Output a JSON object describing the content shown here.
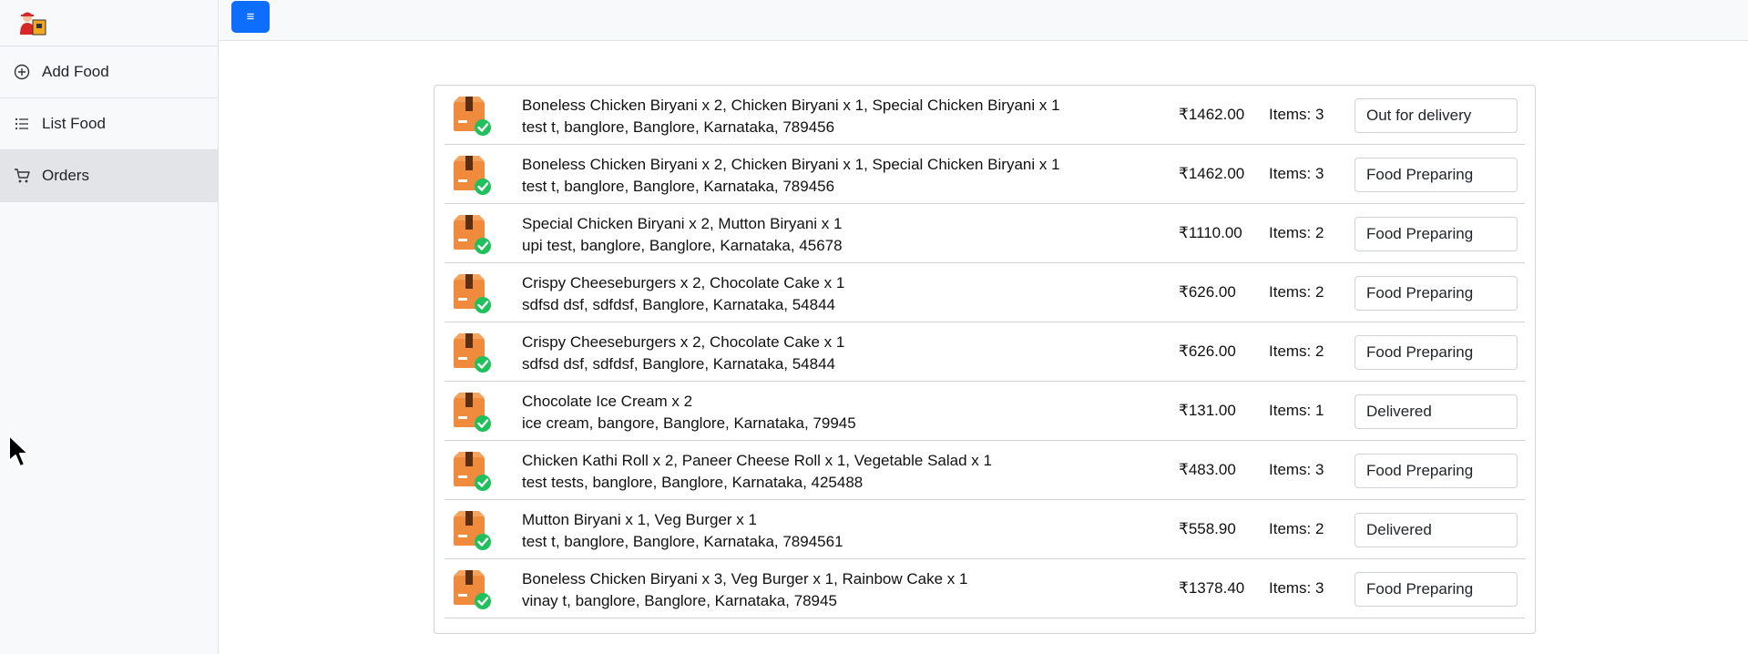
{
  "sidebar": {
    "logo_icon": "delivery-person-icon",
    "items": [
      {
        "label": "Add Food",
        "icon": "plus-circle-icon"
      },
      {
        "label": "List Food",
        "icon": "list-icon"
      },
      {
        "label": "Orders",
        "icon": "cart-icon",
        "active": true
      }
    ]
  },
  "topbar": {
    "menu_icon": "hamburger-icon",
    "menu_glyph": "≡"
  },
  "colors": {
    "primary": "#0d6efd",
    "accent_orange": "#f08a3c",
    "check_green": "#20c05c"
  },
  "orders": [
    {
      "items_line": "Boneless Chicken Biryani x 2, Chicken Biryani x 1, Special Chicken Biryani x 1",
      "address": "test t, banglore, Banglore, Karnataka, 789456",
      "amount": "₹1462.00",
      "count": "Items: 3",
      "status": "Out for delivery"
    },
    {
      "items_line": "Boneless Chicken Biryani x 2, Chicken Biryani x 1, Special Chicken Biryani x 1",
      "address": "test t, banglore, Banglore, Karnataka, 789456",
      "amount": "₹1462.00",
      "count": "Items: 3",
      "status": "Food Preparing"
    },
    {
      "items_line": "Special Chicken Biryani x 2, Mutton Biryani x 1",
      "address": "upi test, banglore, Banglore, Karnataka, 45678",
      "amount": "₹1110.00",
      "count": "Items: 2",
      "status": "Food Preparing"
    },
    {
      "items_line": "Crispy Cheeseburgers x 2, Chocolate Cake x 1",
      "address": "sdfsd dsf, sdfdsf, Banglore, Karnataka, 54844",
      "amount": "₹626.00",
      "count": "Items: 2",
      "status": "Food Preparing"
    },
    {
      "items_line": "Crispy Cheeseburgers x 2, Chocolate Cake x 1",
      "address": "sdfsd dsf, sdfdsf, Banglore, Karnataka, 54844",
      "amount": "₹626.00",
      "count": "Items: 2",
      "status": "Food Preparing"
    },
    {
      "items_line": "Chocolate Ice Cream x 2",
      "address": "ice cream, bangore, Banglore, Karnataka, 79945",
      "amount": "₹131.00",
      "count": "Items: 1",
      "status": "Delivered"
    },
    {
      "items_line": "Chicken Kathi Roll x 2, Paneer Cheese Roll x 1, Vegetable Salad x 1",
      "address": "test tests, banglore, Banglore, Karnataka, 425488",
      "amount": "₹483.00",
      "count": "Items: 3",
      "status": "Food Preparing"
    },
    {
      "items_line": "Mutton Biryani x 1, Veg Burger x 1",
      "address": "test t, banglore, Banglore, Karnataka, 7894561",
      "amount": "₹558.90",
      "count": "Items: 2",
      "status": "Delivered"
    },
    {
      "items_line": "Boneless Chicken Biryani x 3, Veg Burger x 1, Rainbow Cake x 1",
      "address": "vinay t, banglore, Banglore, Karnataka, 78945",
      "amount": "₹1378.40",
      "count": "Items: 3",
      "status": "Food Preparing"
    }
  ]
}
